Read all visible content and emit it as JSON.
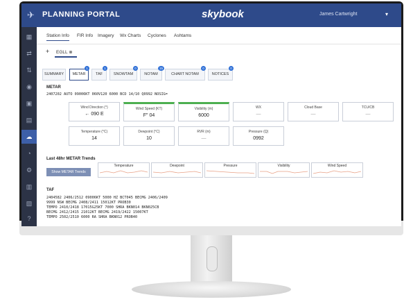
{
  "app": {
    "title": "PLANNING PORTAL",
    "brand": "skybook",
    "user": "James Cartwright"
  },
  "tabs": [
    "Station Info",
    "FIR Info",
    "Imagery",
    "Wx Charts",
    "Cyclones",
    "Ashtams"
  ],
  "station": {
    "code": "EGLL"
  },
  "subtabs": [
    {
      "label": "SUMMARY",
      "badge": ""
    },
    {
      "label": "METAR",
      "badge": "1"
    },
    {
      "label": "TAF",
      "badge": "1"
    },
    {
      "label": "SNOWTAM",
      "badge": "0"
    },
    {
      "label": "NOTAM",
      "badge": "15"
    },
    {
      "label": "CHART NOTAM",
      "badge": "0"
    },
    {
      "label": "NOTICES",
      "badge": "0"
    }
  ],
  "metar": {
    "title": "METAR",
    "raw": "2407202 AUTO 09006KT 060V120 6000 BCD 14/10 Q0992 NOSIG=",
    "cards": [
      {
        "label": "Wind Direction (°)",
        "value": "← 090 E"
      },
      {
        "label": "Wind Speed (KT)",
        "value": "F″ 04"
      },
      {
        "label": "Visibility (m)",
        "value": "6000"
      },
      {
        "label": "WX",
        "value": "—"
      },
      {
        "label": "Cloud Base",
        "value": "—"
      },
      {
        "label": "TCU/CB",
        "value": "—"
      },
      {
        "label": "Temperature (°C)",
        "value": "14"
      },
      {
        "label": "Dewpoint (°C)",
        "value": "10"
      },
      {
        "label": "RVR (m)",
        "value": "—"
      },
      {
        "label": "Pressure (Q)",
        "value": "0992"
      }
    ]
  },
  "trends": {
    "title": "Last 48hr METAR Trends",
    "button": "Show METAR Trends",
    "items": [
      "Temperature",
      "Dewpoint",
      "Pressure",
      "Visibility",
      "Wind Speed"
    ]
  },
  "taf": {
    "title": "TAF",
    "lines": [
      "2404582 2406/2512 09006KT 5000 HZ BCT045 BECMG 2406/2409",
      "9999 NSW BECMG 2408/2411 15012KT PROB30",
      "TEMPO 2410/2418 17015G25KT 7000 SHRA BKN014 BKN025CB",
      "BECMG 2412/2415 21012KT BECMG 2419/2422 15007KT",
      "TEMPO 2502/2510 6000 RA SHRA BKN012 PROB40"
    ]
  },
  "colors": {
    "topbar": "#2e4a8a",
    "sidebar": "#2c3346",
    "accent": "#2e6fd6",
    "green": "#4caf50"
  }
}
